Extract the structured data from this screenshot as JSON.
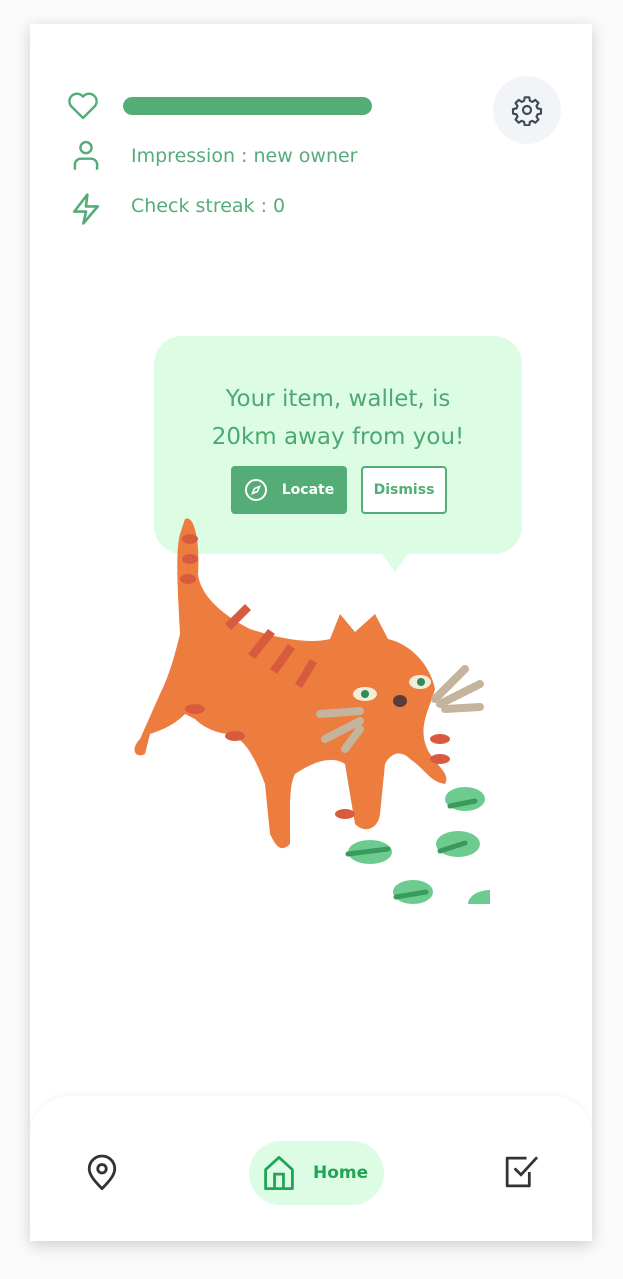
{
  "status": {
    "health_fraction": 1.0,
    "impression_label": "Impression : new owner",
    "streak_label": "Check streak : 0"
  },
  "alert": {
    "line1": "Your item, wallet, is",
    "line2": "20km away from you!",
    "locate_label": "Locate",
    "dismiss_label": "Dismiss"
  },
  "nav": {
    "home_label": "Home"
  },
  "colors": {
    "accent": "#54ad77",
    "bubble": "#dcfde4",
    "nav_active": "#22a456"
  }
}
